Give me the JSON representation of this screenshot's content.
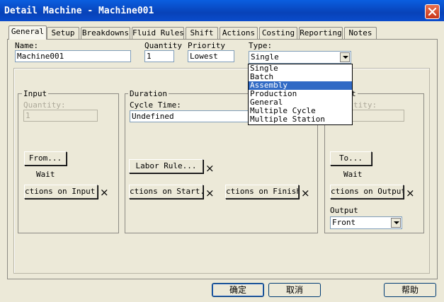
{
  "window": {
    "title": "Detail Machine - Machine001"
  },
  "tabs": [
    "General",
    "Setup",
    "Breakdowns",
    "Fluid Rules",
    "Shift",
    "Actions",
    "Costing",
    "Reporting",
    "Notes"
  ],
  "header": {
    "name_label": "Name:",
    "name_value": "Machine001",
    "quantity_label": "Quantity",
    "quantity_value": "1",
    "priority_label": "Priority",
    "priority_value": "Lowest",
    "type_label": "Type:",
    "type_value": "Single"
  },
  "type_options": [
    "Single",
    "Batch",
    "Assembly",
    "Production",
    "General",
    "Multiple Cycle",
    "Multiple Station"
  ],
  "type_selected": "Assembly",
  "input_group": {
    "title": "Input",
    "quantity_label": "Quantity:",
    "quantity_value": "1",
    "from_button": "From...",
    "wait_label": "Wait",
    "actions_button": "ctions on Input..."
  },
  "duration_group": {
    "title": "Duration",
    "cycle_time_label": "Cycle Time:",
    "cycle_time_value": "Undefined",
    "labor_rule_button": "Labor Rule...",
    "actions_start_button": "ctions on Start...",
    "actions_finish_button": "ctions on Finish..."
  },
  "output_group": {
    "title_visible": "t",
    "quantity_label": "tity:",
    "to_button": "To...",
    "wait_label": "Wait",
    "actions_button": "ctions on Output...",
    "output_label": "Output",
    "output_value": "Front"
  },
  "footer": {
    "ok": "确定",
    "cancel": "取消",
    "help": "帮助"
  },
  "icons": {
    "remove": "×"
  },
  "colors": {
    "titlebar": "#0a4ccc",
    "selection": "#316ac5",
    "face": "#ece9d8"
  }
}
